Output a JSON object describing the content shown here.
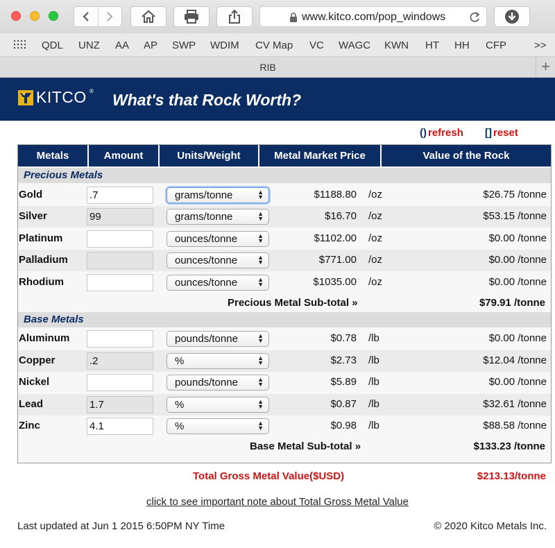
{
  "browser": {
    "url": "www.kitco.com/pop_windows",
    "tab_title": "RIB",
    "bookmarks": [
      "QDL",
      "UNZ",
      "AA",
      "AP",
      "SWP",
      "WDIM",
      "CV Map",
      "VC",
      "WAGC",
      "KWN",
      "HT",
      "HH",
      "CFP"
    ],
    "overflow": ">>",
    "new_tab": "+"
  },
  "banner": {
    "logo": "KITCO",
    "title": "What's that Rock Worth?"
  },
  "actions": {
    "refresh": "refresh",
    "reset": "reset"
  },
  "table": {
    "headers": [
      "Metals",
      "Amount",
      "Units/Weight",
      "Metal Market Price",
      "Value of the Rock"
    ],
    "precious_title": "Precious Metals",
    "precious": [
      {
        "name": "Gold",
        "amount": ".7",
        "unit": "grams/tonne",
        "price": "$1188.80",
        "per": "/oz",
        "value": "$26.75 /tonne"
      },
      {
        "name": "Silver",
        "amount": "99",
        "unit": "grams/tonne",
        "price": "$16.70",
        "per": "/oz",
        "value": "$53.15 /tonne"
      },
      {
        "name": "Platinum",
        "amount": "",
        "unit": "ounces/tonne",
        "price": "$1102.00",
        "per": "/oz",
        "value": "$0.00 /tonne"
      },
      {
        "name": "Palladium",
        "amount": "",
        "unit": "ounces/tonne",
        "price": "$771.00",
        "per": "/oz",
        "value": "$0.00 /tonne"
      },
      {
        "name": "Rhodium",
        "amount": "",
        "unit": "ounces/tonne",
        "price": "$1035.00",
        "per": "/oz",
        "value": "$0.00 /tonne"
      }
    ],
    "precious_subtotal_label": "Precious Metal Sub-total »",
    "precious_subtotal_value": "$79.91 /tonne",
    "base_title": "Base Metals",
    "base": [
      {
        "name": "Aluminum",
        "amount": "",
        "unit": "pounds/tonne",
        "price": "$0.78",
        "per": "/lb",
        "value": "$0.00 /tonne"
      },
      {
        "name": "Copper",
        "amount": ".2",
        "unit": "%",
        "price": "$2.73",
        "per": "/lb",
        "value": "$12.04 /tonne"
      },
      {
        "name": "Nickel",
        "amount": "",
        "unit": "pounds/tonne",
        "price": "$5.89",
        "per": "/lb",
        "value": "$0.00 /tonne"
      },
      {
        "name": "Lead",
        "amount": "1.7",
        "unit": "%",
        "price": "$0.87",
        "per": "/lb",
        "value": "$32.61 /tonne"
      },
      {
        "name": "Zinc",
        "amount": "4.1",
        "unit": "%",
        "price": "$0.98",
        "per": "/lb",
        "value": "$88.58 /tonne"
      }
    ],
    "base_subtotal_label": "Base Metal Sub-total »",
    "base_subtotal_value": "$133.23 /tonne"
  },
  "totals": {
    "label": "Total Gross Metal Value($USD)",
    "value": "$213.13/tonne"
  },
  "footer": {
    "note_link": "click to see important note about Total Gross Metal Value",
    "updated": "Last updated at Jun 1 2015 6:50PM NY Time",
    "copyright": "© 2020 Kitco Metals Inc."
  },
  "colors": {
    "navy": "#0c2d63",
    "accent_red": "#cc1414"
  }
}
